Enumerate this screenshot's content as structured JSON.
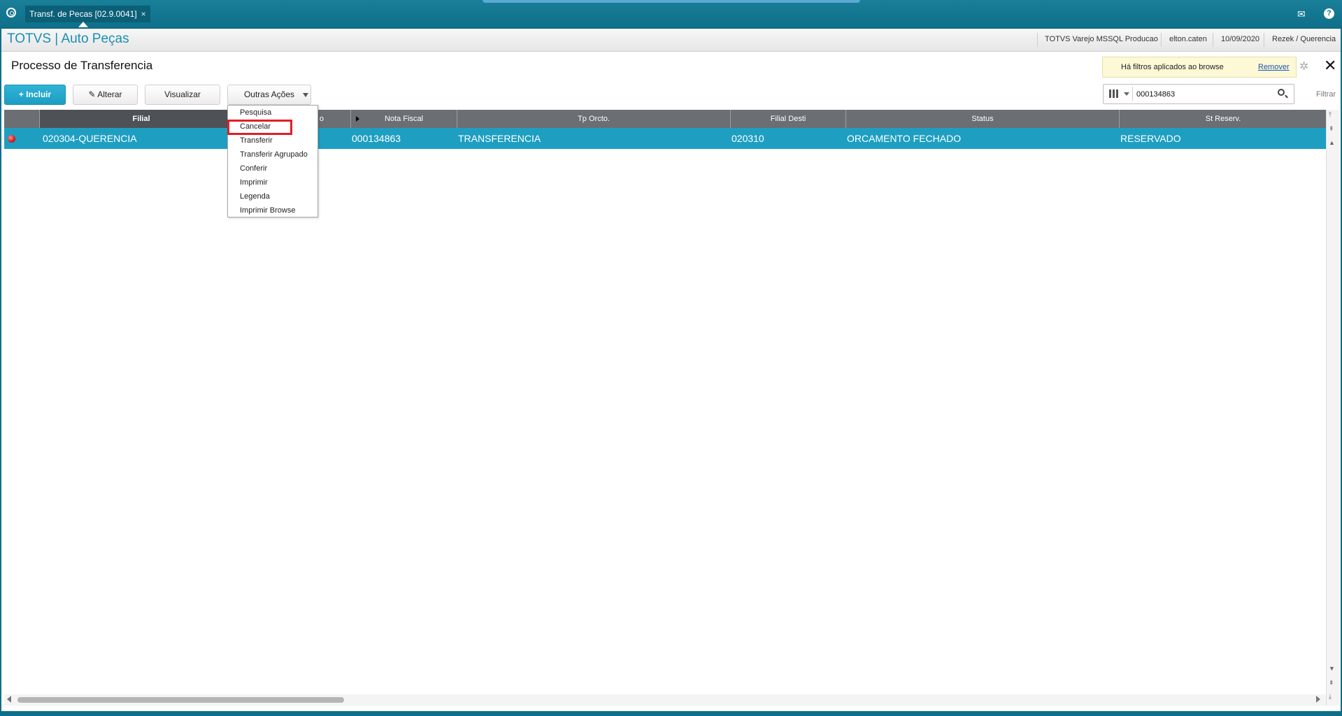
{
  "window": {
    "tab_title": "Transf. de Pecas [02.9.0041]",
    "tab_close": "×"
  },
  "header": {
    "app_title": "TOTVS | Auto Peças",
    "environment": "TOTVS Varejo MSSQL Producao",
    "user": "elton.caten",
    "date": "10/09/2020",
    "company": "Rezek / Querencia"
  },
  "page": {
    "title": "Processo de Transferencia"
  },
  "filter_notice": {
    "text": "Há filtros aplicados ao browse",
    "remove_label": "Remover"
  },
  "toolbar": {
    "incluir_label": "Incluir",
    "alterar_label": "Alterar",
    "visualizar_label": "Visualizar",
    "outras_acoes_label": "Outras Ações"
  },
  "menu": {
    "items": [
      {
        "label": "Pesquisa"
      },
      {
        "label": "Cancelar"
      },
      {
        "label": "Transferir"
      },
      {
        "label": "Transferir Agrupado"
      },
      {
        "label": "Conferir"
      },
      {
        "label": "Imprimir"
      },
      {
        "label": "Legenda"
      },
      {
        "label": "Imprimir Browse"
      }
    ],
    "highlighted": "Cancelar"
  },
  "search": {
    "value": "000134863",
    "filter_label": "Filtrar"
  },
  "grid": {
    "columns": [
      "Filial",
      "o",
      "Nota Fiscal",
      "Tp Orcto.",
      "Filial Desti",
      "Status",
      "St Reserv."
    ],
    "rows": [
      {
        "status_color": "#d21d1d",
        "filial": "020304-QUERENCIA",
        "nota_fiscal": "000134863",
        "tp_orcto": "TRANSFERENCIA",
        "filial_desti": "020310",
        "status": "ORCAMENTO FECHADO",
        "st_reserv": "RESERVADO"
      }
    ]
  },
  "colors": {
    "topbar": "#0e6f8a",
    "accent": "#1e9fc2",
    "highlight_box": "#e01f26"
  }
}
